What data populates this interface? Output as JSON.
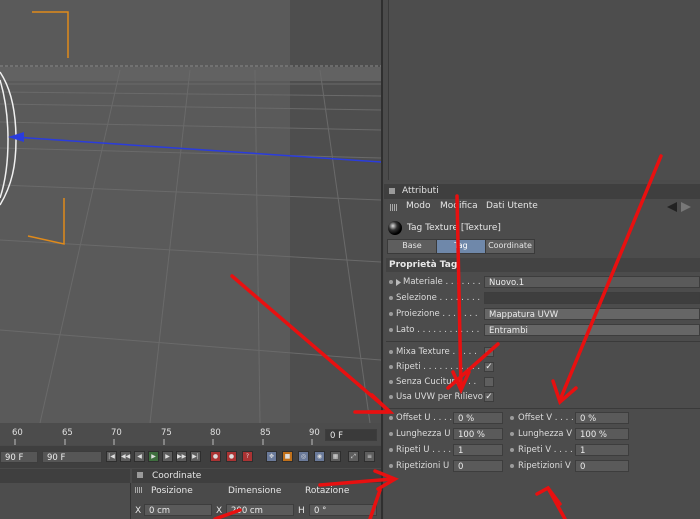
{
  "attributes": {
    "panel_title": "Attributi",
    "menu": [
      "Modo",
      "Modifica",
      "Dati Utente"
    ],
    "object_name": "Tag Texture [Texture]",
    "tabs": [
      "Base",
      "Tag",
      "Coordinate"
    ],
    "active_tab": "Tag",
    "section_title": "Proprietà Tag",
    "props": {
      "materiale_label": "Materiale . . . . . . .",
      "materiale_value": "Nuovo.1",
      "selezione_label": "Selezione . . . . . . . .",
      "selezione_value": "",
      "proiezione_label": "Proiezione . . . . . . .",
      "proiezione_value": "Mappatura UVW",
      "lato_label": "Lato . . . . . . . . . . . .",
      "lato_value": "Entrambi",
      "mixa_label": "Mixa Texture . . . . .",
      "ripeti_label": "Ripeti . . . . . . . . . . .",
      "senza_label": "Senza Cuciture . . .",
      "usauvw_label": "Usa UVW per Rilievo",
      "offset_u_label": "Offset U . . . . .",
      "offset_u_value": "0 %",
      "offset_v_label": "Offset V . . . .",
      "offset_v_value": "0 %",
      "lung_u_label": "Lunghezza U",
      "lung_u_value": "100 %",
      "lung_v_label": "Lunghezza V",
      "lung_v_value": "100 %",
      "ripeti_u_label": "Ripeti U . . . . .",
      "ripeti_u_value": "1",
      "ripeti_v_label": "Ripeti V . . . . .",
      "ripeti_v_value": "1",
      "ripetizioni_u_label": "Ripetizioni U",
      "ripetizioni_u_value": "0",
      "ripetizioni_v_label": "Ripetizioni V",
      "ripetizioni_v_value": "0",
      "check_mark": "✓"
    }
  },
  "timeline": {
    "ticks": [
      "60",
      "65",
      "70",
      "75",
      "80",
      "85",
      "90"
    ],
    "current_frame": "0 F",
    "end_frame_a": "90 F",
    "end_frame_b": "90 F"
  },
  "coordinates": {
    "title": "Coordinate",
    "headers": [
      "Posizione",
      "Dimensione",
      "Rotazione"
    ],
    "x_label": "X",
    "x_pos": "0 cm",
    "x2_label": "X",
    "x_dim": "200 cm",
    "h_label": "H",
    "h_rot": "0 °"
  },
  "colors": {
    "annotation_arrow": "#e81010",
    "active_tab": "#6f88aa",
    "axis_blue": "#2a3cdd",
    "axis_orange": "#e08a1a"
  }
}
